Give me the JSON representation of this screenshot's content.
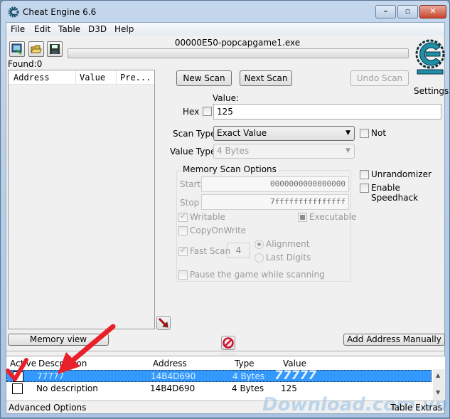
{
  "window": {
    "title": "Cheat Engine 6.6",
    "buttons": {
      "minimize": "–",
      "maximize": "▫",
      "close": "✕"
    }
  },
  "menu": [
    "File",
    "Edit",
    "Table",
    "D3D",
    "Help"
  ],
  "toolbar": {
    "icons": [
      "open-process-icon",
      "open-file-icon",
      "save-icon"
    ],
    "process_name": "00000E50-popcapgame1.exe",
    "progress_percent": 0
  },
  "found": {
    "label": "Found:0",
    "columns": [
      "Address",
      "Value",
      "Pre..."
    ]
  },
  "scan": {
    "new_scan": "New Scan",
    "next_scan": "Next Scan",
    "undo_scan": "Undo Scan",
    "settings": "Settings",
    "value_label": "Value:",
    "hex_label": "Hex",
    "value": "125",
    "scan_type_label": "Scan Type",
    "scan_type": "Exact Value",
    "not_label": "Not",
    "value_type_label": "Value Type",
    "value_type": "4 Bytes"
  },
  "memory_options": {
    "title": "Memory Scan Options",
    "start_label": "Start",
    "start": "0000000000000000",
    "stop_label": "Stop",
    "stop": "7fffffffffffffff",
    "writable": "Writable",
    "executable": "Executable",
    "copy_on_write": "CopyOnWrite",
    "fast_scan": "Fast Scan",
    "fast_scan_value": "4",
    "alignment": "Alignment",
    "last_digits": "Last Digits",
    "pause": "Pause the game while scanning"
  },
  "side_options": {
    "unrandomizer": "Unrandomizer",
    "speedhack": "Enable Speedhack"
  },
  "buttons": {
    "memory_view": "Memory view",
    "add_address": "Add Address Manually"
  },
  "address_table": {
    "columns": [
      "Active",
      "Description",
      "Address",
      "Type",
      "Value"
    ],
    "rows": [
      {
        "active": false,
        "description": "77777",
        "address": "14B4D690",
        "type": "4 Bytes",
        "value": "77777",
        "selected": true
      },
      {
        "active": false,
        "description": "No description",
        "address": "14B4D690",
        "type": "4 Bytes",
        "value": "125",
        "selected": false
      }
    ]
  },
  "status": {
    "left": "Advanced Options",
    "right": "Table Extras"
  },
  "watermark": "Download.com.vn",
  "colors": {
    "selection": "#3399ff",
    "annotation_arrow": "#e8202a",
    "logo": "#1e8fa6"
  }
}
